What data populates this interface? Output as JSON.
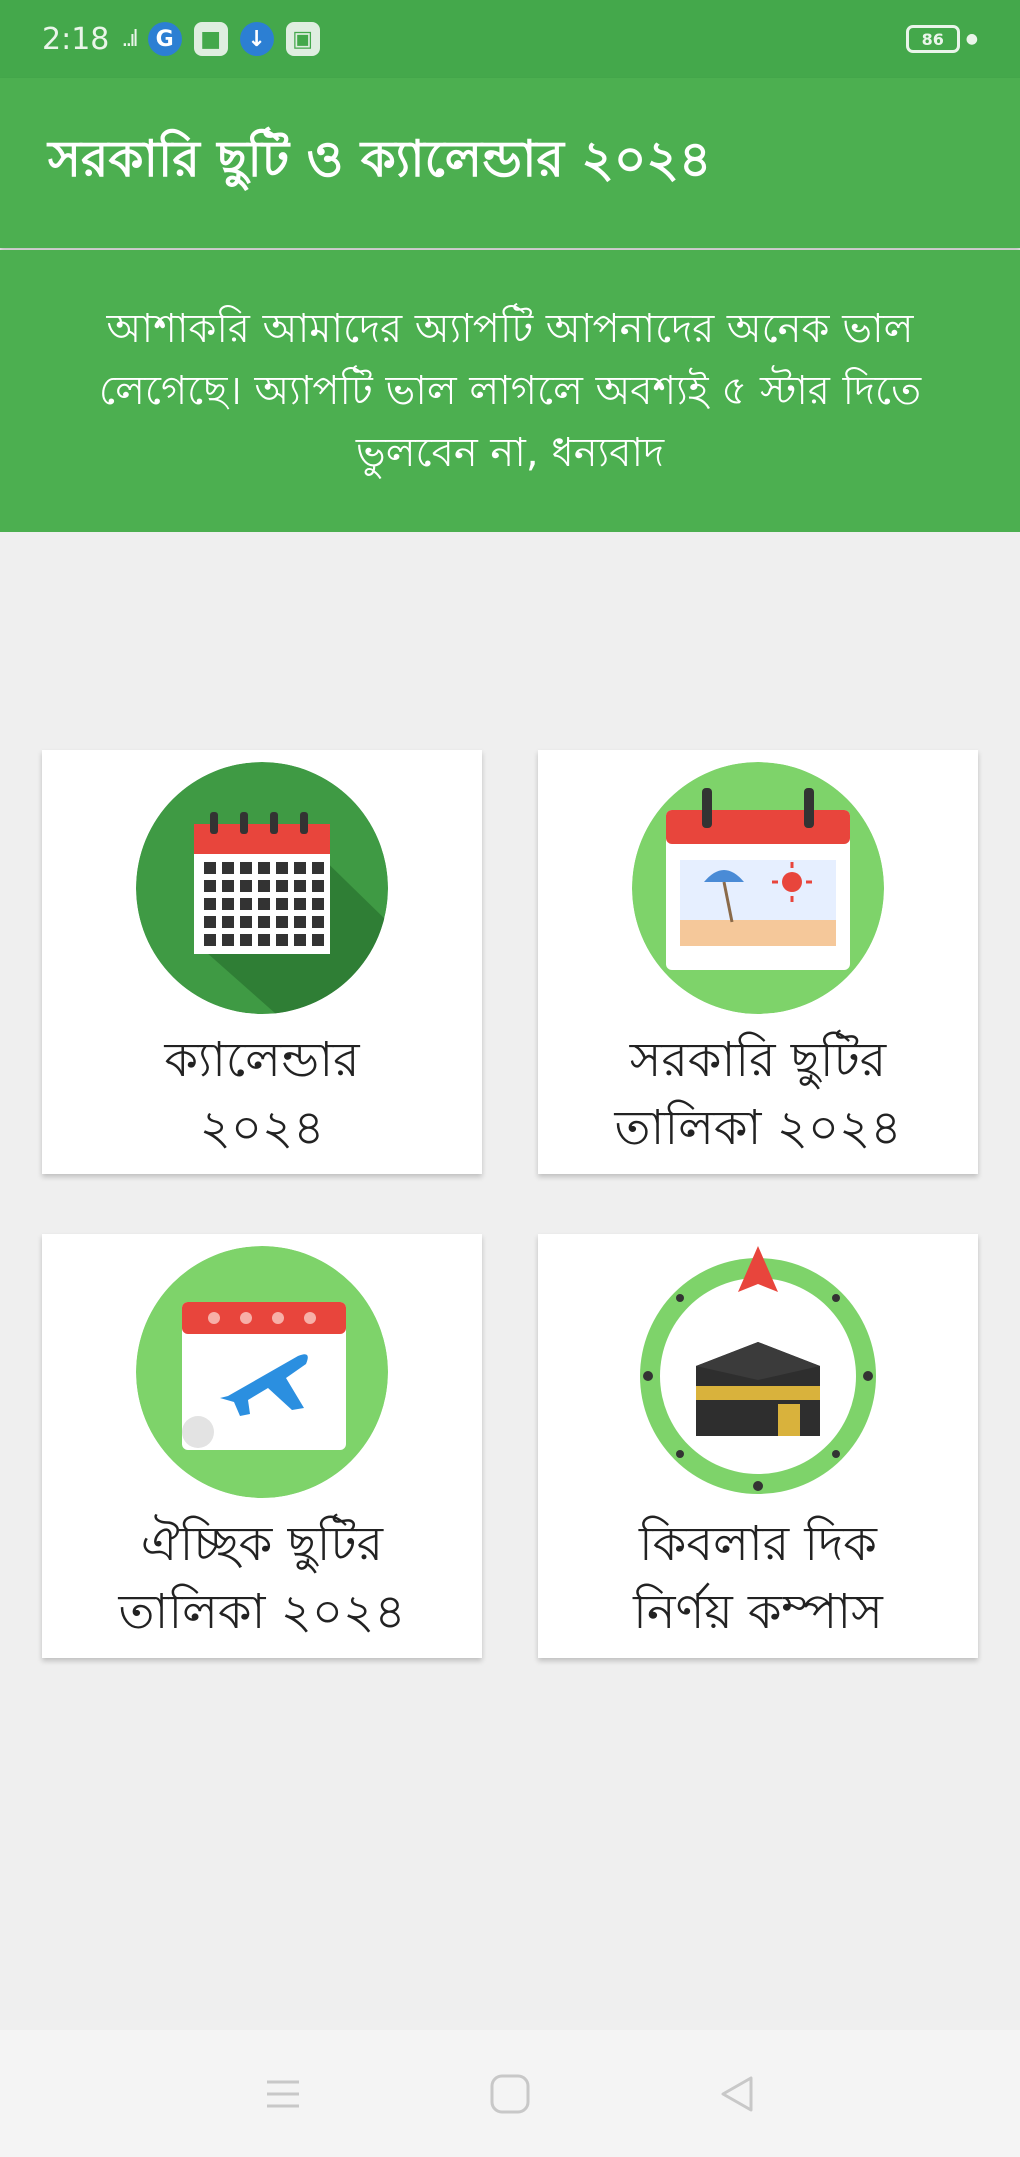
{
  "status_bar": {
    "time": "2:18",
    "signal": "..ıl",
    "battery_level": "86"
  },
  "app_bar": {
    "title": "সরকারি ছুটি ও ক্যালেন্ডার ২০২৪"
  },
  "banner": {
    "message": "আশাকরি আমাদের অ্যাপটি আপনাদের অনেক ভাল লেগেছে। অ্যাপটি ভাল লাগলে অবশ্যই ৫ স্টার দিতে ভুলবেন না, ধন্যবাদ"
  },
  "cards": [
    {
      "label_line1": "ক্যালেন্ডার",
      "label_line2": "২০২৪",
      "icon": "calendar-icon"
    },
    {
      "label_line1": "সরকারি ছুটির",
      "label_line2": "তালিকা ২০২৪",
      "icon": "holiday-calendar-icon"
    },
    {
      "label_line1": "ঐচ্ছিক ছুটির",
      "label_line2": "তালিকা ২০২৪",
      "icon": "travel-calendar-icon"
    },
    {
      "label_line1": "কিবলার দিক",
      "label_line2": "নির্ণয় কম্পাস",
      "icon": "qibla-compass-icon"
    }
  ],
  "colors": {
    "primary": "#4caf50",
    "status_bar": "#44a84b",
    "background": "#efefef",
    "card": "#ffffff",
    "icon_dark_green": "#3f9a44",
    "icon_light_green": "#7ed36a",
    "calendar_red": "#e8453c"
  },
  "nav_bar": {
    "icons": [
      "menu-icon",
      "home-icon",
      "back-icon"
    ]
  }
}
